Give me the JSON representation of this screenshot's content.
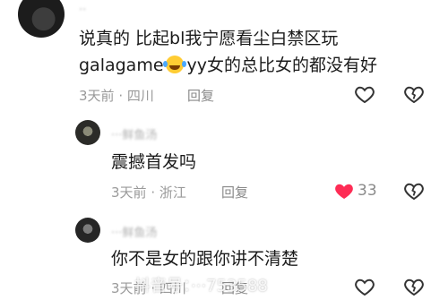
{
  "comments": [
    {
      "username": "··",
      "text_line1": "说真的 比起bl我宁愿看尘白禁区玩",
      "text_line2a": "galagame",
      "text_line2b": "yy女的总比女的都没有好",
      "time": "3天前",
      "location": "四川",
      "reply_label": "回复"
    },
    {
      "username": "···鲜鱼汤",
      "text": "震撼首发吗",
      "time": "3天前",
      "location": "浙江",
      "reply_label": "回复",
      "like_count": "33",
      "liked": true
    },
    {
      "username": "···鲜鱼汤",
      "text": "你不是女的跟你讲不清楚",
      "time": "3天前",
      "location": "四川",
      "reply_label": "回复"
    }
  ],
  "watermark": "抖音号：···753588",
  "colors": {
    "like_active": "#fe2c55",
    "icon_gray": "#333333"
  }
}
